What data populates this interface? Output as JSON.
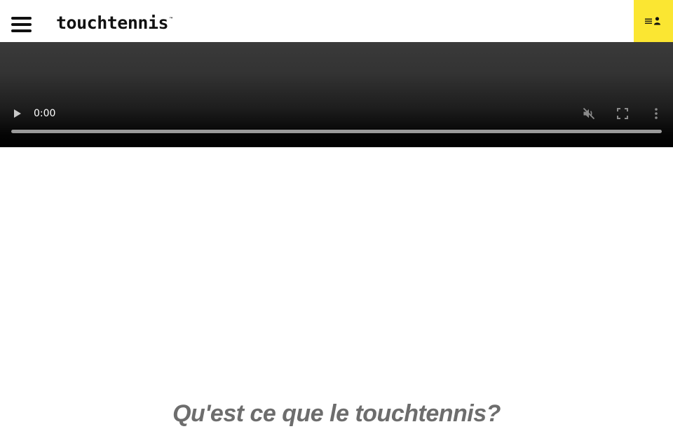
{
  "header": {
    "logo_text": "touchtennis",
    "logo_tm": "™",
    "menu_icon": "hamburger-menu-icon",
    "account_icon": "account-list-user-icon",
    "accent_color": "#fbe632"
  },
  "video": {
    "current_time": "0:00",
    "progress": 0,
    "controls": [
      "play-icon",
      "muted-volume-icon",
      "fullscreen-icon",
      "more-options-icon"
    ]
  },
  "main": {
    "section_title": "Qu'est ce que le touchtennis?"
  }
}
